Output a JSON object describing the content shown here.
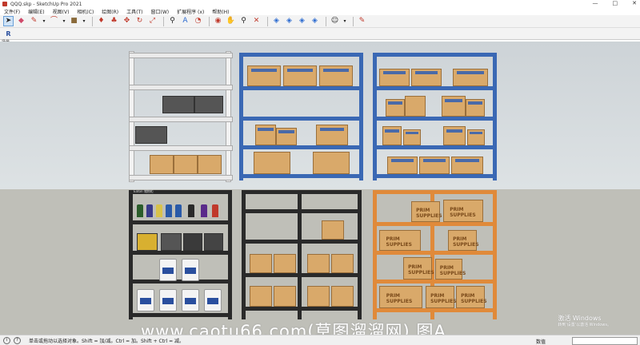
{
  "window": {
    "title": "QQQ.skp - SketchUp Pro 2021",
    "controls": [
      "—",
      "□",
      "✕"
    ]
  },
  "menu": [
    "文件(F)",
    "编辑(E)",
    "视图(V)",
    "相机(C)",
    "绘图(R)",
    "工具(T)",
    "窗口(W)",
    "扩展程序 (x)",
    "帮助(H)"
  ],
  "toolbar": {
    "tools": [
      "select-icon",
      "eraser-icon",
      "pencil-icon",
      "dropdown",
      "arc-icon",
      "dropdown",
      "paint-bucket-icon",
      "dropdown",
      "push-pull-icon",
      "follow-me-icon",
      "move-icon",
      "rotate-icon",
      "scale-icon",
      "zoom-icon",
      "zoom-window-icon",
      "zoom-extents-icon",
      "orbit-icon",
      "pan-icon",
      "look-around-icon",
      "position-camera-icon",
      "walk-icon",
      "section-icon",
      "section-fill-icon",
      "section-display-icon",
      "solar-icon",
      "dropdown",
      "text-icon"
    ]
  },
  "scene": {
    "tab_label": "场景",
    "shelf_sign": "Eaton 储物柜",
    "box_brand": "PRIM SUPPLIES"
  },
  "colors": {
    "white_shelf": "#f2f2f2",
    "blue_shelf": "#3a68b4",
    "black_shelf": "#2a2a2a",
    "orange_shelf": "#e08a3a",
    "box": "#d9a96a"
  },
  "status": {
    "hint": "单击或拖动以选择对象。Shift = 加/减。Ctrl = 加。Shift + Ctrl = 减。",
    "measure_label": "数值"
  },
  "overlay": {
    "watermark": "www.caotu66.com(草图溜溜网) 图A",
    "activate_line1": "激活 Windows",
    "activate_line2": "转到'设置'以激活 Windows。"
  }
}
